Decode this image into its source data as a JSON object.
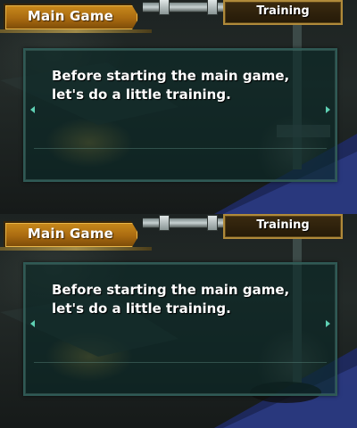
{
  "screens": [
    {
      "main_tab": {
        "label": "Main Game"
      },
      "training_tab": {
        "label": "Training"
      },
      "dialog": {
        "lines": [
          "Before starting the main game,",
          "let's do a little training."
        ],
        "prev_icon": "arrow-left-icon",
        "next_icon": "arrow-right-icon"
      }
    },
    {
      "main_tab": {
        "label": "Main Game"
      },
      "training_tab": {
        "label": "Training"
      },
      "dialog": {
        "lines": [
          "Before starting the main game,",
          "let's do a little training."
        ],
        "prev_icon": "arrow-left-icon",
        "next_icon": "arrow-right-icon"
      }
    }
  ],
  "colors": {
    "main_tab_fill": "#c98a1c",
    "training_tab_border": "#b08a3a",
    "dialog_border": "#2f5a55",
    "arrow": "#5fd1b4"
  }
}
